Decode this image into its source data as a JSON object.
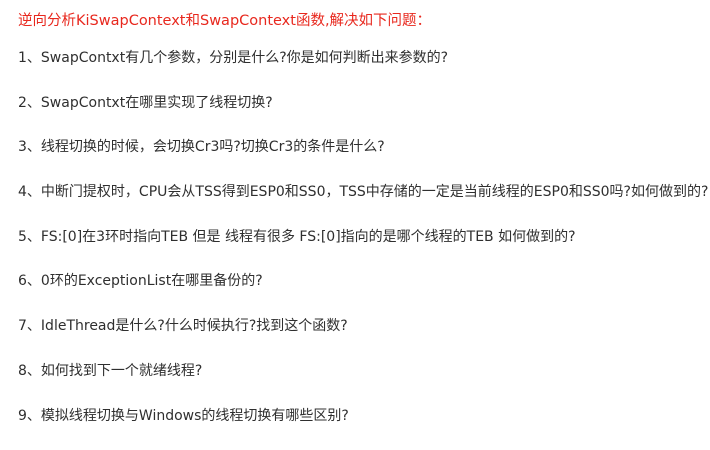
{
  "heading": "逆向分析KiSwapContext和SwapContext函数,解决如下问题：",
  "questions": [
    {
      "num": "1、",
      "text": "SwapContxt有几个参数，分别是什么?你是如何判断出来参数的?"
    },
    {
      "num": "2、",
      "text": "SwapContxt在哪里实现了线程切换?"
    },
    {
      "num": "3、",
      "text": "线程切换的时候，会切换Cr3吗?切换Cr3的条件是什么?"
    },
    {
      "num": "4、",
      "text": "中断门提权时，CPU会从TSS得到ESP0和SS0，TSS中存储的一定是当前线程的ESP0和SS0吗?如何做到的?"
    },
    {
      "num": "5、",
      "text": "FS:[0]在3环时指向TEB  但是 线程有很多 FS:[0]指向的是哪个线程的TEB 如何做到的?"
    },
    {
      "num": "6、",
      "text": "0环的ExceptionList在哪里备份的?"
    },
    {
      "num": "7、",
      "text": "IdleThread是什么?什么时候执行?找到这个函数?"
    },
    {
      "num": "8、",
      "text": "如何找到下一个就绪线程?"
    },
    {
      "num": "9、",
      "text": "模拟线程切换与Windows的线程切换有哪些区别?"
    }
  ]
}
